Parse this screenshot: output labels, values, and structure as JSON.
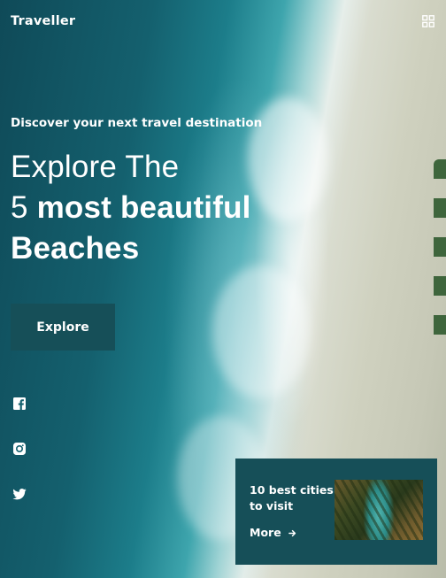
{
  "header": {
    "brand": "Traveller",
    "menu_icon": "grid-menu-icon"
  },
  "hero": {
    "tagline": "Discover your next travel destination",
    "headline_line1": "Explore The",
    "headline_number": "5",
    "headline_bold": "most beautiful",
    "headline_line3": "Beaches",
    "explore_label": "Explore"
  },
  "social": [
    {
      "icon": "facebook-icon"
    },
    {
      "icon": "instagram-icon"
    },
    {
      "icon": "twitter-icon"
    }
  ],
  "card": {
    "title": "10 best cities to visit",
    "more_label": "More",
    "more_icon": "arrow-right-icon",
    "image_icon": "tropical-river-thumbnail"
  },
  "colors": {
    "accent": "#164f58",
    "text": "#ffffff",
    "sea": "#14606e",
    "sand": "#cfd1bf"
  }
}
